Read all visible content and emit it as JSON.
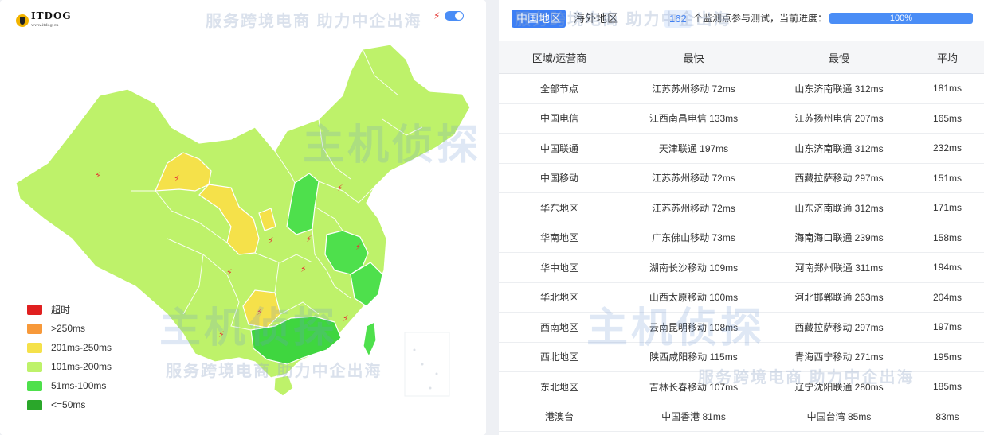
{
  "left": {
    "logo": {
      "text": "ITDOG",
      "sub": "www.itdog.cn"
    },
    "watermark_text": "服务跨境电商 助力中企出海",
    "watermark_brand": "主机侦探",
    "legend": [
      {
        "label": "超时",
        "color": "#e02020"
      },
      {
        "label": ">250ms",
        "color": "#f7993a"
      },
      {
        "label": "201ms-250ms",
        "color": "#f5e14a"
      },
      {
        "label": "101ms-200ms",
        "color": "#bef26a"
      },
      {
        "label": "51ms-100ms",
        "color": "#4ee04c"
      },
      {
        "label": "<=50ms",
        "color": "#2aa72a"
      }
    ],
    "toggle_on": true
  },
  "right": {
    "tabs": [
      {
        "label": "中国地区",
        "active": true
      },
      {
        "label": "海外地区",
        "active": false
      }
    ],
    "monitor_count": "162",
    "progress_text": "个监测点参与测试，当前进度：",
    "progress": {
      "value": 100,
      "label": "100%"
    },
    "table": {
      "headers": [
        "区域/运营商",
        "最快",
        "最慢",
        "平均"
      ],
      "rows": [
        [
          "全部节点",
          "江苏苏州移动 72ms",
          "山东济南联通 312ms",
          "181ms"
        ],
        [
          "中国电信",
          "江西南昌电信 133ms",
          "江苏扬州电信 207ms",
          "165ms"
        ],
        [
          "中国联通",
          "天津联通 197ms",
          "山东济南联通 312ms",
          "232ms"
        ],
        [
          "中国移动",
          "江苏苏州移动 72ms",
          "西藏拉萨移动 297ms",
          "151ms"
        ],
        [
          "华东地区",
          "江苏苏州移动 72ms",
          "山东济南联通 312ms",
          "171ms"
        ],
        [
          "华南地区",
          "广东佛山移动 73ms",
          "海南海口联通 239ms",
          "158ms"
        ],
        [
          "华中地区",
          "湖南长沙移动 109ms",
          "河南郑州联通 311ms",
          "194ms"
        ],
        [
          "华北地区",
          "山西太原移动 100ms",
          "河北邯郸联通 263ms",
          "204ms"
        ],
        [
          "西南地区",
          "云南昆明移动 108ms",
          "西藏拉萨移动 297ms",
          "197ms"
        ],
        [
          "西北地区",
          "陕西咸阳移动 115ms",
          "青海西宁移动 271ms",
          "195ms"
        ],
        [
          "东北地区",
          "吉林长春移动 107ms",
          "辽宁沈阳联通 280ms",
          "185ms"
        ],
        [
          "港澳台",
          "中国香港 81ms",
          "中国台湾 85ms",
          "83ms"
        ]
      ]
    }
  }
}
